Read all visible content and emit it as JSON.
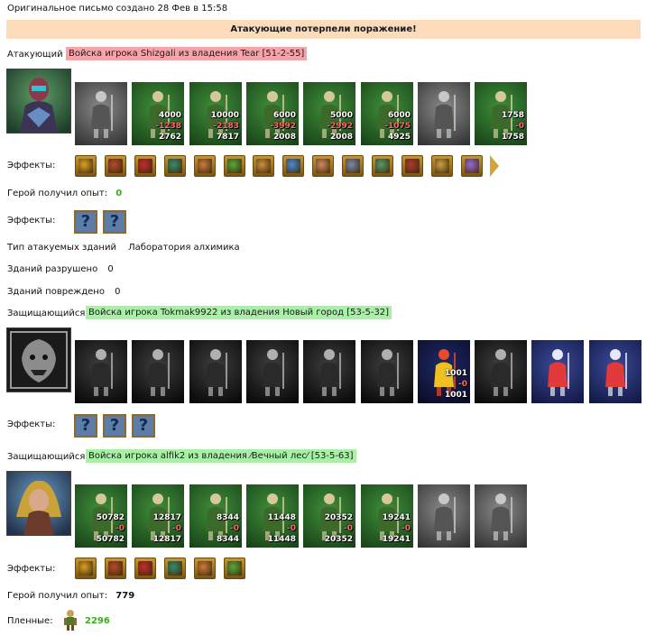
{
  "header": {
    "created": "Оригинальное письмо создано 28 Фев в 15:58"
  },
  "banner": {
    "text": "Атакующие потерпели поражение!"
  },
  "attacker": {
    "label": "Атакующий",
    "tag": "Войска игрока Shizgali из владения Tear [51-2-55]",
    "units": [
      {
        "style": "gray",
        "n1": "",
        "n2": "",
        "n3": ""
      },
      {
        "style": "green",
        "n1": "4000",
        "n2": "-1238",
        "n3": "2762"
      },
      {
        "style": "green",
        "n1": "10000",
        "n2": "-2183",
        "n3": "7817"
      },
      {
        "style": "green",
        "n1": "6000",
        "n2": "-3992",
        "n3": "2008"
      },
      {
        "style": "green",
        "n1": "5000",
        "n2": "-2992",
        "n3": "2008"
      },
      {
        "style": "green",
        "n1": "6000",
        "n2": "-1075",
        "n3": "4925"
      },
      {
        "style": "gray",
        "n1": "",
        "n2": "",
        "n3": ""
      },
      {
        "style": "green",
        "n1": "1758",
        "n2": "-0",
        "n3": "1758"
      }
    ],
    "effects_label": "Эффекты:",
    "effects": [
      "coins-icon",
      "chest-icon",
      "dice-icon",
      "shield-icon",
      "handshake-icon",
      "sword-icon",
      "hands-icon",
      "glove-icon",
      "scroll-icon",
      "web-icon",
      "armor-icon",
      "ring-icon",
      "box-icon",
      "staff-icon"
    ],
    "exp_label": "Герой получил опыт:",
    "exp_value": "0",
    "effects2_label": "Эффекты:",
    "building_type_label": "Тип атакуемых зданий",
    "building_type_value": "Лаборатория алхимика",
    "destroyed_label": "Зданий разрушено",
    "destroyed_value": "0",
    "damaged_label": "Зданий повреждено",
    "damaged_value": "0"
  },
  "defender1": {
    "label": "Защищающийся",
    "tag": "Войска игрока Tokmak9922 из владения Новый город [53-5-32]",
    "units": [
      {
        "style": "dark",
        "n1": "",
        "n2": "",
        "n3": ""
      },
      {
        "style": "dark",
        "n1": "",
        "n2": "",
        "n3": ""
      },
      {
        "style": "dark",
        "n1": "",
        "n2": "",
        "n3": ""
      },
      {
        "style": "dark",
        "n1": "",
        "n2": "",
        "n3": ""
      },
      {
        "style": "dark",
        "n1": "",
        "n2": "",
        "n3": ""
      },
      {
        "style": "dark",
        "n1": "",
        "n2": "",
        "n3": ""
      },
      {
        "style": "red",
        "n1": "1001",
        "n2": "-0",
        "n3": "1001"
      },
      {
        "style": "dark",
        "n1": "",
        "n2": "",
        "n3": ""
      },
      {
        "style": "blue",
        "n1": "",
        "n2": "",
        "n3": ""
      },
      {
        "style": "blue",
        "n1": "",
        "n2": "",
        "n3": ""
      }
    ],
    "effects_label": "Эффекты:"
  },
  "defender2": {
    "label": "Защищающийся",
    "tag": "Войска игрока alfik2 из владения ⁄Вечный лес⁄ [53-5-63]",
    "units": [
      {
        "style": "green",
        "n1": "50782",
        "n2": "-0",
        "n3": "50782"
      },
      {
        "style": "green",
        "n1": "12817",
        "n2": "-0",
        "n3": "12817"
      },
      {
        "style": "green",
        "n1": "8344",
        "n2": "-0",
        "n3": "8344"
      },
      {
        "style": "green",
        "n1": "11448",
        "n2": "-0",
        "n3": "11448"
      },
      {
        "style": "green",
        "n1": "20352",
        "n2": "-0",
        "n3": "20352"
      },
      {
        "style": "green",
        "n1": "19241",
        "n2": "-0",
        "n3": "19241"
      },
      {
        "style": "gray",
        "n1": "",
        "n2": "",
        "n3": ""
      },
      {
        "style": "gray",
        "n1": "",
        "n2": "",
        "n3": ""
      }
    ],
    "effects_label": "Эффекты:",
    "effects": [
      "door-icon",
      "gear-icon",
      "staff-icon",
      "heart-icon",
      "hearts-icon",
      "potion-icon"
    ],
    "exp_label": "Герой получил опыт:",
    "exp_value": "779",
    "prisoners_label": "Пленные:",
    "prisoners_value": "2296"
  }
}
